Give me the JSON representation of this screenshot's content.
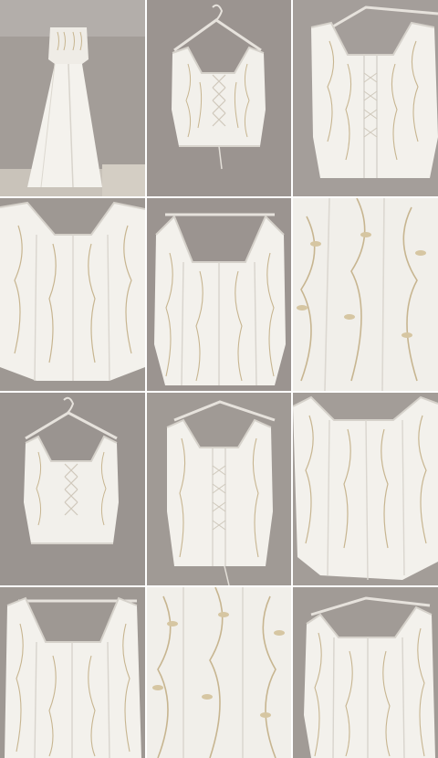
{
  "gallery": {
    "background": "#ffffff",
    "wall_color": "#9c9696",
    "wall_shade": "#7f7878",
    "satin_color": "#f3f1ec",
    "satin_shade": "#d9d6cf",
    "embroidery_color": "#c8b48c",
    "hanger_color": "#e9e6e1",
    "tiles": [
      {
        "subject": "gown-full-length",
        "row": 1,
        "col": 1
      },
      {
        "subject": "bodice-front-lace-up",
        "row": 1,
        "col": 2
      },
      {
        "subject": "bodice-back-close",
        "row": 1,
        "col": 3
      },
      {
        "subject": "bodice-front-close",
        "row": 2,
        "col": 1
      },
      {
        "subject": "bodice-front-straps",
        "row": 2,
        "col": 2
      },
      {
        "subject": "embroidery-detail",
        "row": 2,
        "col": 3
      },
      {
        "subject": "bodice-lace-up-hanger",
        "row": 3,
        "col": 1
      },
      {
        "subject": "bodice-back-hanger",
        "row": 3,
        "col": 2
      },
      {
        "subject": "bodice-side-close",
        "row": 3,
        "col": 3
      },
      {
        "subject": "bodice-back-straps",
        "row": 4,
        "col": 1
      },
      {
        "subject": "embroidery-detail-2",
        "row": 4,
        "col": 2
      },
      {
        "subject": "bodice-front-angled",
        "row": 4,
        "col": 3
      }
    ]
  }
}
